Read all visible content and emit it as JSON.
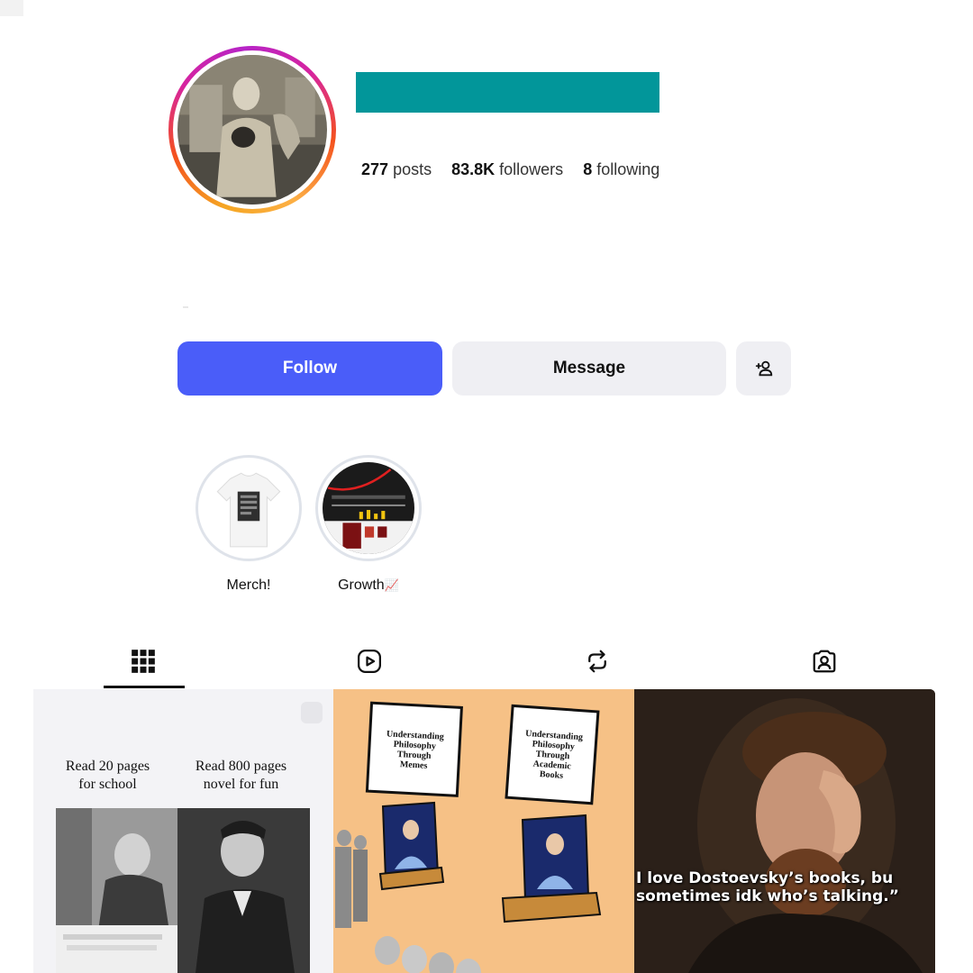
{
  "profile": {
    "stats": {
      "posts_count": "277",
      "posts_label": "posts",
      "followers_count": "83.8K",
      "followers_label": "followers",
      "following_count": "8",
      "following_label": "following"
    },
    "avatar": "profile-photo-man-with-cat"
  },
  "actions": {
    "follow_label": "Follow",
    "message_label": "Message",
    "add_user_icon": "add-user-icon"
  },
  "highlights": [
    {
      "label": "Merch!",
      "cover": "tshirt-image"
    },
    {
      "label": "Growth",
      "emoji": "📈",
      "cover": "analytics-screenshot"
    }
  ],
  "tabs": [
    {
      "name": "posts",
      "icon": "grid-icon",
      "active": true
    },
    {
      "name": "reels",
      "icon": "reels-play-icon",
      "active": false
    },
    {
      "name": "reposts",
      "icon": "repost-icon",
      "active": false
    },
    {
      "name": "tagged",
      "icon": "tagged-person-icon",
      "active": false
    }
  ],
  "posts": [
    {
      "type": "meme",
      "left_caption": "Read 20 pages\nfor school",
      "right_caption": "Read 800 pages\nnovel for fun"
    },
    {
      "type": "comic",
      "sign_left": "Understanding\nPhilosophy\nThrough\nMemes",
      "sign_right": "Understanding\nPhilosophy\nThrough\nAcademic\nBooks"
    },
    {
      "type": "quote",
      "quote_line1": "I love Dostoevsky’s books, bu",
      "quote_line2": "sometimes idk who’s talking.”"
    }
  ],
  "colors": {
    "follow_button": "#4a5df9",
    "secondary_button": "#efeff3",
    "username_redaction": "#02969a",
    "story_ring_start": "#d6249f",
    "story_ring_end": "#f5a623"
  }
}
